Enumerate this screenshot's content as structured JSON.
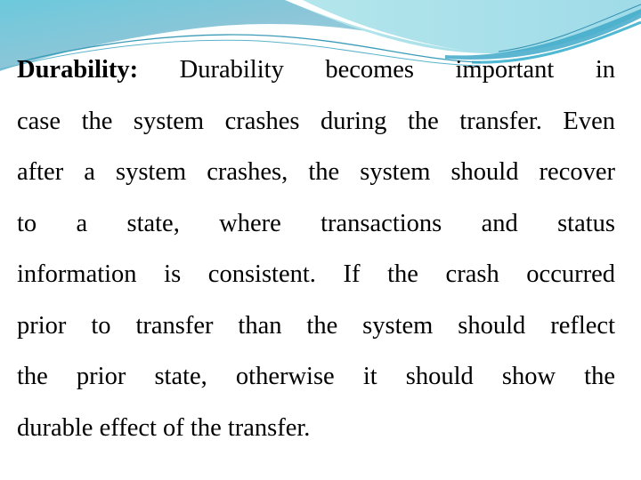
{
  "slide": {
    "heading_term": "Durability:",
    "lines": [
      "Durability becomes important in",
      "case the system crashes during the transfer. Even",
      "after a system crashes, the system should recover",
      "to a state, where transactions and status",
      "information is consistent. If the crash occurred",
      "prior to transfer than the system should reflect",
      "the prior state, otherwise it should show the",
      "durable effect of the transfer."
    ]
  },
  "theme": {
    "wave_dark": "#7fc3d6",
    "wave_light": "#a8e0ea",
    "wave_accent": "#3fa9c9"
  }
}
